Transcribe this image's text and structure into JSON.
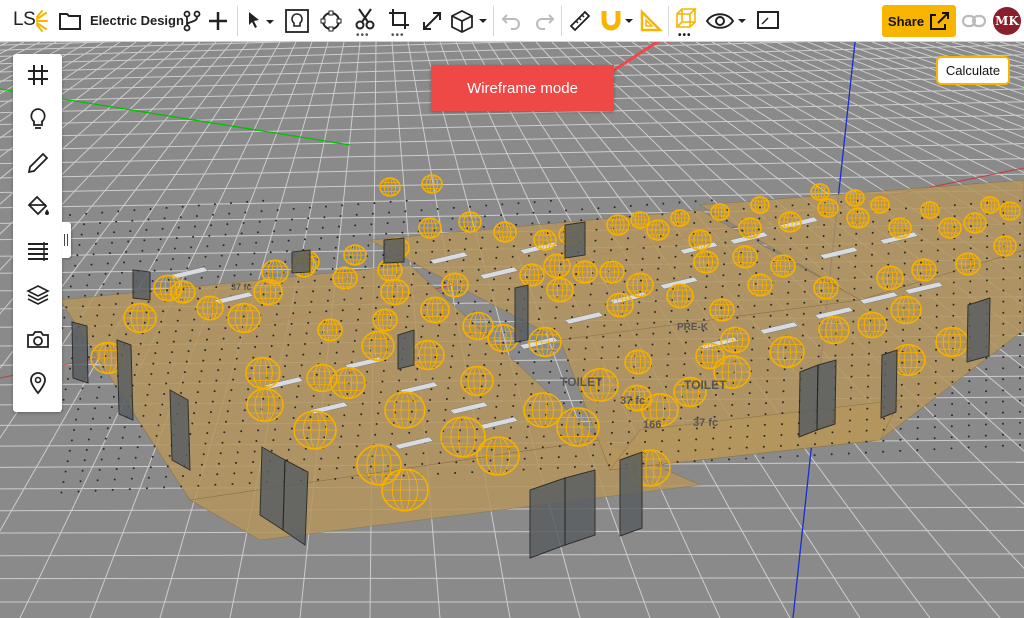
{
  "app": {
    "logo": "LS",
    "project_title": "Electric Design"
  },
  "toolbar": {
    "share_label": "Share",
    "avatar_initials": "MK",
    "more_dots": "•••"
  },
  "left_panel": {
    "tools": [
      "grid-icon",
      "bulb-icon",
      "pencil-icon",
      "paint-bucket-icon",
      "list-icon",
      "layers-icon",
      "camera-icon",
      "location-pin-icon"
    ]
  },
  "viewport": {
    "calculate_label": "Calculate",
    "callout_text": "Wireframe mode",
    "room_labels": [
      "TOILET",
      "37 fc",
      "TOILET",
      "37 fc",
      "166",
      "PRE-K",
      "37 fc"
    ]
  },
  "colors": {
    "accent": "#f7b500",
    "callout": "#ee4847",
    "floor": "#b5965e",
    "background": "#8a8a8a",
    "light": "#f5b000"
  }
}
